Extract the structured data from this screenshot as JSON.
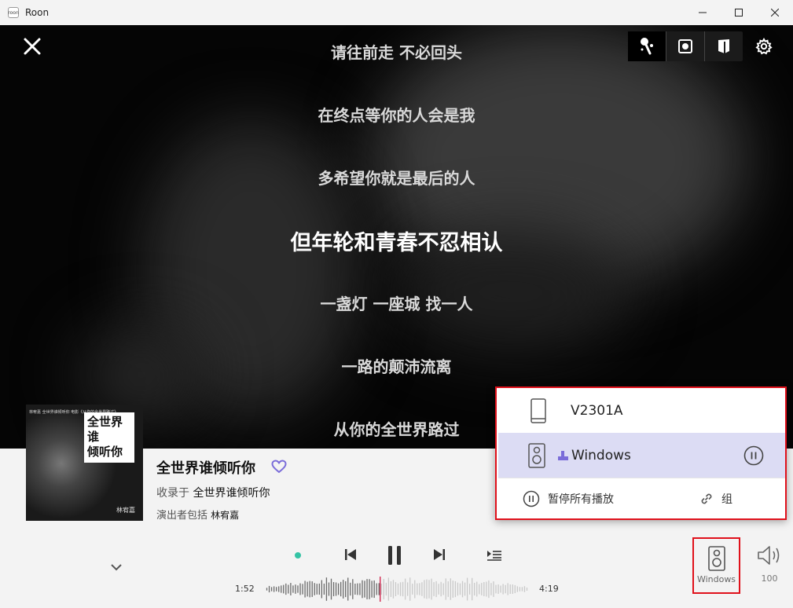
{
  "window": {
    "title": "Roon",
    "app_icon_text": "roon"
  },
  "lyrics": {
    "lines": [
      "请往前走 不必回头",
      "在终点等你的人会是我",
      "多希望你就是最后的人",
      "但年轮和青春不忍相认",
      "一盏灯 一座城 找一人",
      "一路的颠沛流离",
      "从你的全世界路过"
    ],
    "active_index": 3
  },
  "view_modes": [
    "lyrics-mode-icon",
    "album-art-mode-icon",
    "booklet-mode-icon"
  ],
  "album_art": {
    "card_text_line1": "全世界",
    "card_text_line2": "谁",
    "card_text_line3": "倾听你",
    "tiny_text": "林宥嘉 全世界谁倾听你 电影《从你的全世界路过》",
    "signature": "林宥嘉"
  },
  "track": {
    "title": "全世界谁倾听你",
    "album_prefix": "收录于",
    "album": "全世界谁倾听你",
    "artist_prefix": "演出者包括",
    "artist": "林宥嘉"
  },
  "playback": {
    "elapsed": "1:52",
    "duration": "4:19",
    "progress": 0.432
  },
  "zone": {
    "label": "Windows"
  },
  "volume": {
    "value": "100"
  },
  "zone_popup": {
    "devices": [
      {
        "name": "V2301A",
        "icon": "phone-icon",
        "playing": false
      },
      {
        "name": "Windows",
        "icon": "speaker-icon",
        "playing": true
      }
    ],
    "pause_all_label": "暂停所有播放",
    "group_label": "组"
  },
  "colors": {
    "accent": "#7a6cd9",
    "highlight_border": "#e0111b",
    "indicator": "#34c3a4"
  }
}
